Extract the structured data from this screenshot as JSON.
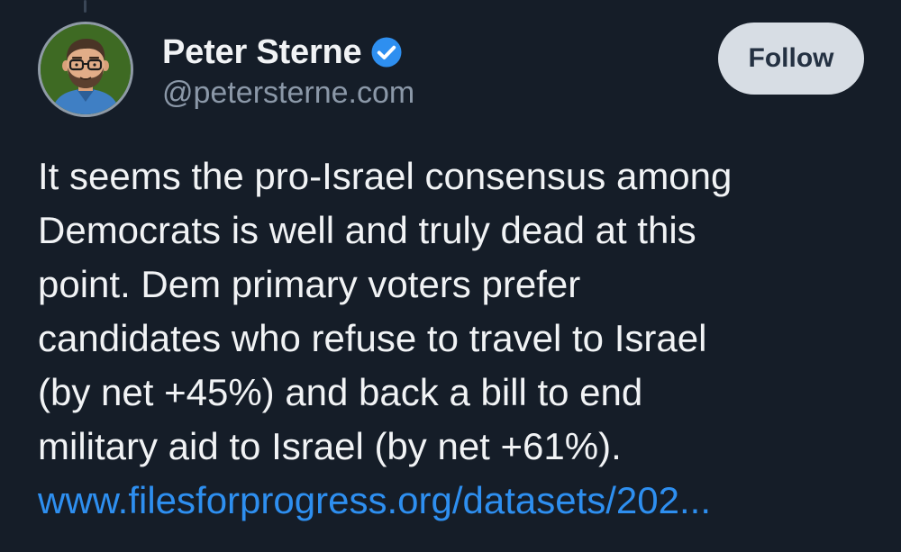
{
  "post": {
    "author": {
      "display_name": "Peter Sterne",
      "handle": "@petersterne.com",
      "verified": true,
      "avatar_icon": "cartoon-avatar-icon",
      "verified_icon": "verified-badge-icon"
    },
    "follow_label": "Follow",
    "text_lines": [
      "It seems the pro-Israel consensus among",
      "Democrats is well and truly dead at this",
      "point. Dem primary voters prefer",
      "candidates who refuse to travel to Israel",
      "(by net +45%) and back a bill to end",
      "military aid to Israel (by net +61%)."
    ],
    "link_text": "www.filesforprogress.org/datasets/202..."
  },
  "colors": {
    "background": "#151d28",
    "primary_text": "#f1f3f5",
    "secondary_text": "#8b98a8",
    "link": "#2e8ff0",
    "verified_badge": "#2e8ff0",
    "follow_button_bg": "#d7dde4",
    "follow_button_text": "#243142"
  }
}
